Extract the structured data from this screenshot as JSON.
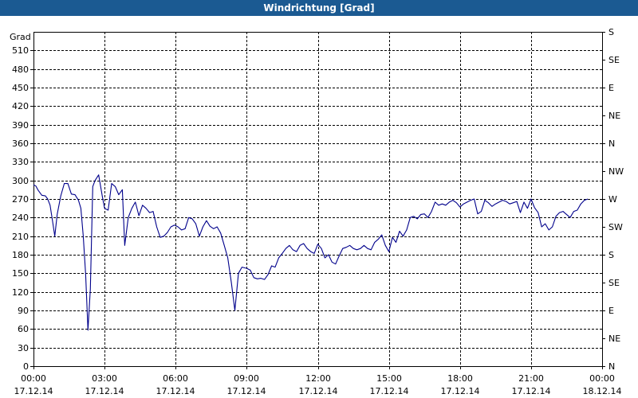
{
  "window": {
    "title": "Windrichtung [Grad]"
  },
  "chart_data": {
    "type": "line",
    "title": "Windrichtung [Grad]",
    "ylabel": "Grad",
    "xlabel": "",
    "grid": true,
    "ylim": [
      0,
      540
    ],
    "y_ticks": [
      0,
      30,
      60,
      90,
      120,
      150,
      180,
      210,
      240,
      270,
      300,
      330,
      360,
      390,
      420,
      450,
      480,
      510
    ],
    "y2_ticks": [
      {
        "value": 0,
        "label": "N"
      },
      {
        "value": 45,
        "label": "NE"
      },
      {
        "value": 90,
        "label": "E"
      },
      {
        "value": 135,
        "label": "SE"
      },
      {
        "value": 180,
        "label": "S"
      },
      {
        "value": 225,
        "label": "SW"
      },
      {
        "value": 270,
        "label": "W"
      },
      {
        "value": 315,
        "label": "NW"
      },
      {
        "value": 360,
        "label": "N"
      },
      {
        "value": 405,
        "label": "NE"
      },
      {
        "value": 450,
        "label": "E"
      },
      {
        "value": 495,
        "label": "SE"
      },
      {
        "value": 540,
        "label": "S"
      }
    ],
    "xlim": [
      "17.12.14 00:00",
      "18.12.14 00:00"
    ],
    "x_ticks": [
      {
        "time": "00:00",
        "date": "17.12.14",
        "hour": 0
      },
      {
        "time": "03:00",
        "date": "17.12.14",
        "hour": 3
      },
      {
        "time": "06:00",
        "date": "17.12.14",
        "hour": 6
      },
      {
        "time": "09:00",
        "date": "17.12.14",
        "hour": 9
      },
      {
        "time": "12:00",
        "date": "17.12.14",
        "hour": 12
      },
      {
        "time": "15:00",
        "date": "17.12.14",
        "hour": 15
      },
      {
        "time": "18:00",
        "date": "17.12.14",
        "hour": 18
      },
      {
        "time": "21:00",
        "date": "17.12.14",
        "hour": 21
      },
      {
        "time": "00:00",
        "date": "18.12.14",
        "hour": 24
      }
    ],
    "series": [
      {
        "color": "#00008b",
        "x_hours": [
          0,
          0.1,
          0.2,
          0.35,
          0.5,
          0.6,
          0.7,
          0.8,
          0.9,
          1.0,
          1.15,
          1.3,
          1.45,
          1.6,
          1.75,
          1.9,
          2.0,
          2.1,
          2.2,
          2.3,
          2.4,
          2.5,
          2.6,
          2.75,
          2.9,
          3.0,
          3.15,
          3.3,
          3.45,
          3.6,
          3.75,
          3.85,
          4.0,
          4.15,
          4.3,
          4.45,
          4.6,
          4.75,
          4.9,
          5.05,
          5.2,
          5.35,
          5.5,
          5.65,
          5.8,
          5.95,
          6.1,
          6.25,
          6.4,
          6.55,
          6.7,
          6.85,
          7.0,
          7.15,
          7.3,
          7.45,
          7.6,
          7.75,
          7.9,
          8.05,
          8.2,
          8.35,
          8.5,
          8.65,
          8.8,
          9.0,
          9.15,
          9.3,
          9.45,
          9.6,
          9.75,
          9.9,
          10.05,
          10.2,
          10.35,
          10.5,
          10.65,
          10.8,
          10.95,
          11.1,
          11.25,
          11.4,
          11.55,
          11.7,
          11.85,
          12.0,
          12.15,
          12.3,
          12.45,
          12.6,
          12.75,
          12.9,
          13.05,
          13.2,
          13.35,
          13.5,
          13.65,
          13.8,
          13.95,
          14.1,
          14.25,
          14.4,
          14.55,
          14.7,
          14.85,
          15.0,
          15.15,
          15.3,
          15.45,
          15.6,
          15.75,
          15.9,
          16.05,
          16.2,
          16.35,
          16.5,
          16.65,
          16.8,
          16.95,
          17.1,
          17.25,
          17.4,
          17.55,
          17.7,
          17.85,
          18.0,
          18.15,
          18.3,
          18.45,
          18.6,
          18.75,
          18.9,
          19.05,
          19.2,
          19.35,
          19.5,
          19.65,
          19.8,
          19.95,
          20.1,
          20.25,
          20.4,
          20.55,
          20.7,
          20.85,
          21.0,
          21.15,
          21.3,
          21.45,
          21.6,
          21.75,
          21.9,
          22.05,
          22.2,
          22.35,
          22.5,
          22.65,
          22.8,
          22.95,
          23.1,
          23.25,
          23.4,
          23.55,
          23.7,
          23.85,
          24.0
        ],
        "y": [
          293,
          291,
          284,
          276,
          275,
          270,
          260,
          235,
          210,
          245,
          275,
          295,
          295,
          278,
          277,
          268,
          255,
          210,
          148,
          58,
          125,
          290,
          300,
          309,
          275,
          255,
          252,
          295,
          290,
          277,
          285,
          195,
          240,
          255,
          265,
          243,
          260,
          255,
          248,
          250,
          225,
          208,
          210,
          216,
          225,
          228,
          225,
          220,
          222,
          240,
          238,
          230,
          210,
          225,
          235,
          226,
          222,
          225,
          215,
          195,
          175,
          135,
          90,
          150,
          160,
          158,
          155,
          143,
          141,
          142,
          140,
          148,
          162,
          160,
          175,
          182,
          190,
          195,
          188,
          185,
          195,
          198,
          190,
          185,
          182,
          197,
          190,
          175,
          180,
          168,
          165,
          178,
          190,
          192,
          195,
          190,
          188,
          190,
          195,
          190,
          188,
          200,
          205,
          212,
          195,
          185,
          208,
          200,
          218,
          210,
          220,
          240,
          242,
          238,
          245,
          246,
          240,
          250,
          265,
          260,
          262,
          260,
          265,
          268,
          264,
          257,
          262,
          265,
          268,
          270,
          246,
          250,
          268,
          264,
          258,
          262,
          265,
          268,
          266,
          262,
          264,
          266,
          248,
          265,
          255,
          270,
          256,
          248,
          225,
          230,
          220,
          225,
          242,
          248,
          250,
          245,
          240,
          250,
          252,
          262,
          268,
          270
        ]
      }
    ]
  }
}
